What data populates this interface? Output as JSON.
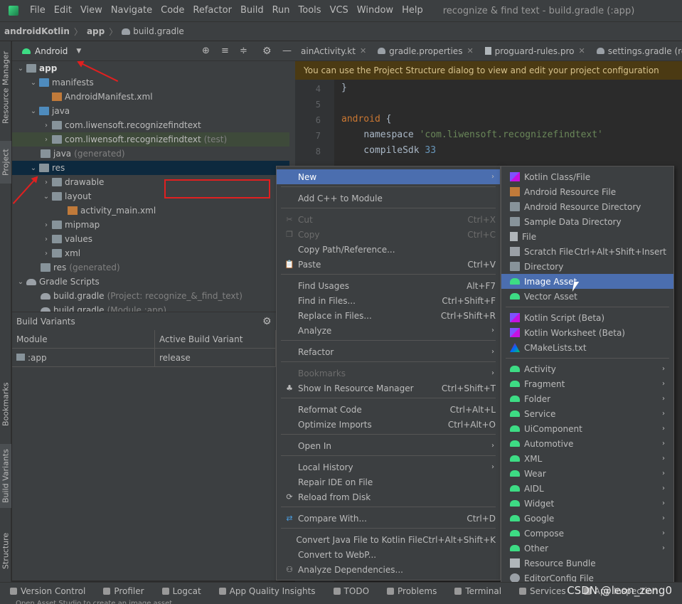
{
  "menubar": {
    "items": [
      "File",
      "Edit",
      "View",
      "Navigate",
      "Code",
      "Refactor",
      "Build",
      "Run",
      "Tools",
      "VCS",
      "Window",
      "Help"
    ],
    "window_title": "recognize & find text - build.gradle (:app)"
  },
  "breadcrumb": [
    "androidKotlin",
    "app",
    "build.gradle"
  ],
  "left_tabs": [
    "Resource Manager",
    "Project",
    "Bookmarks",
    "Build Variants",
    "Structure"
  ],
  "project": {
    "view_selector": "Android",
    "tree": [
      {
        "label": "app",
        "bold": true
      },
      {
        "label": "manifests"
      },
      {
        "label": "AndroidManifest.xml"
      },
      {
        "label": "java"
      },
      {
        "label": "com.liwensoft.recognizefindtext"
      },
      {
        "label": "com.liwensoft.recognizefindtext",
        "suffix": "(test)"
      },
      {
        "label": "java",
        "suffix": "(generated)"
      },
      {
        "label": "res"
      },
      {
        "label": "drawable"
      },
      {
        "label": "layout"
      },
      {
        "label": "activity_main.xml"
      },
      {
        "label": "mipmap"
      },
      {
        "label": "values"
      },
      {
        "label": "xml"
      },
      {
        "label": "res",
        "suffix": "(generated)"
      },
      {
        "label": "Gradle Scripts"
      },
      {
        "label": "build.gradle",
        "suffix": "(Project: recognize_&_find_text)"
      },
      {
        "label": "build.gradle",
        "suffix": "(Module :app)"
      }
    ]
  },
  "build_variants": {
    "title": "Build Variants",
    "col_module": "Module",
    "col_variant": "Active Build Variant",
    "module": ":app",
    "variant": "release"
  },
  "editor": {
    "tabs": [
      "ainActivity.kt",
      "gradle.properties",
      "proguard-rules.pro",
      "settings.gradle (recogniz"
    ],
    "notice": "You can use the Project Structure dialog to view and edit your project configuration",
    "line_numbers": [
      "4",
      "5",
      "6",
      "7",
      "8"
    ],
    "lines": [
      "}",
      "",
      "android {",
      "    namespace 'com.liwensoft.recognizefindtext'",
      "    compileSdk 33"
    ]
  },
  "context_menu": [
    {
      "label": "New",
      "arrow": true,
      "active": true
    },
    {
      "label": "Add C++ to Module"
    },
    {
      "label": "Cut",
      "shortcut": "Ctrl+X",
      "disabled": true
    },
    {
      "label": "Copy",
      "shortcut": "Ctrl+C",
      "disabled": true
    },
    {
      "label": "Copy Path/Reference..."
    },
    {
      "label": "Paste",
      "shortcut": "Ctrl+V"
    },
    {
      "label": "Find Usages",
      "shortcut": "Alt+F7"
    },
    {
      "label": "Find in Files...",
      "shortcut": "Ctrl+Shift+F"
    },
    {
      "label": "Replace in Files...",
      "shortcut": "Ctrl+Shift+R"
    },
    {
      "label": "Analyze",
      "arrow": true
    },
    {
      "label": "Refactor",
      "arrow": true
    },
    {
      "label": "Bookmarks",
      "arrow": true,
      "disabled": true
    },
    {
      "label": "Show In Resource Manager",
      "shortcut": "Ctrl+Shift+T"
    },
    {
      "label": "Reformat Code",
      "shortcut": "Ctrl+Alt+L"
    },
    {
      "label": "Optimize Imports",
      "shortcut": "Ctrl+Alt+O"
    },
    {
      "label": "Open In",
      "arrow": true
    },
    {
      "label": "Local History",
      "arrow": true
    },
    {
      "label": "Repair IDE on File"
    },
    {
      "label": "Reload from Disk"
    },
    {
      "label": "Compare With...",
      "shortcut": "Ctrl+D"
    },
    {
      "label": "Convert Java File to Kotlin File",
      "shortcut": "Ctrl+Alt+Shift+K"
    },
    {
      "label": "Convert to WebP..."
    },
    {
      "label": "Analyze Dependencies..."
    }
  ],
  "new_submenu": [
    {
      "label": "Kotlin Class/File",
      "icon": "kotlin-icon"
    },
    {
      "label": "Android Resource File",
      "icon": "android-resource-file-icon"
    },
    {
      "label": "Android Resource Directory",
      "icon": "folder-icon"
    },
    {
      "label": "Sample Data Directory",
      "icon": "folder-icon"
    },
    {
      "label": "File",
      "icon": "file-icon"
    },
    {
      "label": "Scratch File",
      "shortcut": "Ctrl+Alt+Shift+Insert",
      "icon": "scratch-icon"
    },
    {
      "label": "Directory",
      "icon": "folder-icon"
    },
    {
      "label": "Image Asset",
      "icon": "android-icon",
      "active": true
    },
    {
      "label": "Vector Asset",
      "icon": "android-icon"
    },
    {
      "label": "Kotlin Script (Beta)",
      "icon": "kotlin-icon"
    },
    {
      "label": "Kotlin Worksheet (Beta)",
      "icon": "kotlin-icon"
    },
    {
      "label": "CMakeLists.txt",
      "icon": "cmake-icon"
    },
    {
      "label": "Activity",
      "arrow": true,
      "icon": "android-icon"
    },
    {
      "label": "Fragment",
      "arrow": true,
      "icon": "android-icon"
    },
    {
      "label": "Folder",
      "arrow": true,
      "icon": "android-icon"
    },
    {
      "label": "Service",
      "arrow": true,
      "icon": "android-icon"
    },
    {
      "label": "UiComponent",
      "arrow": true,
      "icon": "android-icon"
    },
    {
      "label": "Automotive",
      "arrow": true,
      "icon": "android-icon"
    },
    {
      "label": "XML",
      "arrow": true,
      "icon": "android-icon"
    },
    {
      "label": "Wear",
      "arrow": true,
      "icon": "android-icon"
    },
    {
      "label": "AIDL",
      "arrow": true,
      "icon": "android-icon"
    },
    {
      "label": "Widget",
      "arrow": true,
      "icon": "android-icon"
    },
    {
      "label": "Google",
      "arrow": true,
      "icon": "android-icon"
    },
    {
      "label": "Compose",
      "arrow": true,
      "icon": "android-icon"
    },
    {
      "label": "Other",
      "arrow": true,
      "icon": "android-icon"
    },
    {
      "label": "Resource Bundle",
      "icon": "resource-bundle-icon"
    },
    {
      "label": "EditorConfig File",
      "icon": "gear-icon"
    }
  ],
  "statusbar": [
    "Version Control",
    "Profiler",
    "Logcat",
    "App Quality Insights",
    "TODO",
    "Problems",
    "Terminal",
    "Services",
    "App Inspection"
  ],
  "status_message": "Open Asset Studio to create an image asset",
  "watermark": "CSDN @leon_zeng0",
  "colors": {
    "accent": "#4b6eaf",
    "selection": "#0d293e",
    "annotation": "#e02020"
  }
}
